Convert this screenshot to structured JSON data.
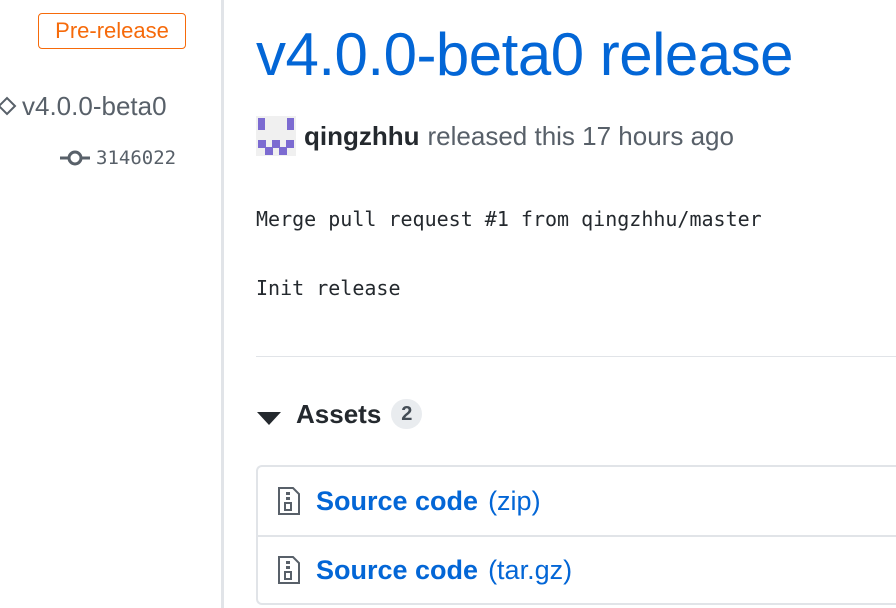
{
  "sidebar": {
    "badge_label": "Pre-release",
    "tag_name": "v4.0.0-beta0",
    "commit_sha": "3146022"
  },
  "release": {
    "title": "v4.0.0-beta0 release",
    "author": "qingzhhu",
    "released_text": "released this 17 hours ago",
    "body_lines": [
      "Merge pull request #1 from qingzhhu/master",
      "Init release"
    ]
  },
  "assets": {
    "heading": "Assets",
    "count": "2",
    "items": [
      {
        "name": "Source code",
        "ext": "(zip)",
        "icon": "file-zip-icon"
      },
      {
        "name": "Source code",
        "ext": "(tar.gz)",
        "icon": "file-zip-icon"
      }
    ]
  },
  "colors": {
    "link": "#0366d6",
    "badge": "#f66a0a",
    "muted": "#586069",
    "avatar": "#7c6bd1"
  }
}
